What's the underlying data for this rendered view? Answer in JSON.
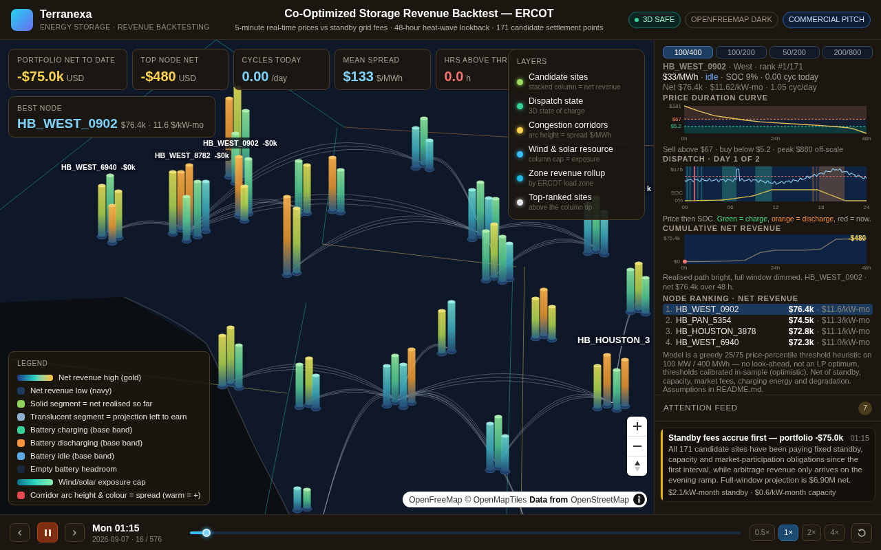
{
  "header": {
    "brand": "Terranexa",
    "tagline": "ENERGY STORAGE · REVENUE BACKTESTING",
    "title": "Co-Optimized Storage Revenue Backtest — ERCOT",
    "subtitle": "5-minute real-time prices vs standby grid fees · 48-hour heat-wave lookback · 171 candidate settlement points",
    "badges": [
      {
        "label": "3D SAFE",
        "kind": "status"
      },
      {
        "label": "OPENFREEMAP DARK",
        "kind": "neutral"
      },
      {
        "label": "COMMERCIAL PITCH",
        "kind": "mode"
      }
    ]
  },
  "kpis": [
    {
      "label": "PORTFOLIO NET TO DATE",
      "value": "-$75.0k",
      "unit": "USD",
      "color": "#fcd34d"
    },
    {
      "label": "TOP NODE NET",
      "value": "-$480",
      "unit": "USD",
      "color": "#fcd34d"
    },
    {
      "label": "CYCLES TODAY",
      "value": "0.00",
      "unit": "/day",
      "color": "#7dd3fc"
    },
    {
      "label": "MEAN SPREAD",
      "value": "$133",
      "unit": "$/MWh",
      "color": "#7dd3fc"
    },
    {
      "label": "HRS ABOVE THR",
      "value": "0.0",
      "unit": "h",
      "color": "#f87171"
    }
  ],
  "best_node": {
    "label": "BEST NODE",
    "name": "HB_WEST_0902",
    "detail": "$76.4k · 11.6 $/kW-mo"
  },
  "layers": {
    "title": "LAYERS",
    "items": [
      {
        "name": "Candidate sites",
        "hint": "stacked column = net revenue",
        "color": "#9ddc5c"
      },
      {
        "name": "Dispatch state",
        "hint": "3D state of charge",
        "color": "#34d399"
      },
      {
        "name": "Congestion corridors",
        "hint": "arc height = spread $/MWh",
        "color": "#fcd34d"
      },
      {
        "name": "Wind & solar resource",
        "hint": "column cap = exposure",
        "color": "#38bdf8"
      },
      {
        "name": "Zone revenue rollup",
        "hint": "by ERCOT load zone",
        "color": "#22b8e6"
      },
      {
        "name": "Top-ranked sites",
        "hint": "above the column tip",
        "color": "#e5e7eb"
      }
    ]
  },
  "map": {
    "site_labels": [
      {
        "name": "HB_WEST_0902",
        "net": "-$0k"
      },
      {
        "name": "HB_WEST_8782",
        "net": "-$0k"
      },
      {
        "name": "HB_WEST_6940",
        "net": "-$0k"
      },
      {
        "net": "k"
      },
      {
        "name": "HB_HOUSTON_3"
      }
    ],
    "attribution": [
      {
        "text": "OpenFreeMap",
        "kind": "link"
      },
      {
        "text": "© OpenMapTiles",
        "kind": "link"
      },
      {
        "text": "Data from",
        "kind": "text"
      },
      {
        "text": "OpenStreetMap",
        "kind": "link"
      }
    ]
  },
  "legend": {
    "title": "LEGEND",
    "items": [
      {
        "label": "Net revenue high (gold)",
        "kind": "revenue_ramp"
      },
      {
        "label": "Net revenue low (navy)",
        "kind": "swatch",
        "color": "#1e3a5f"
      },
      {
        "label": "Solid segment = net realised so far",
        "kind": "swatch",
        "color": "#8ed35a"
      },
      {
        "label": "Translucent segment = projection left to earn",
        "kind": "swatch",
        "color": "#8fb0cf"
      },
      {
        "label": "Battery charging (base band)",
        "kind": "swatch",
        "color": "#34d399"
      },
      {
        "label": "Battery discharging (base band)",
        "kind": "swatch",
        "color": "#fb923c"
      },
      {
        "label": "Battery idle (base band)",
        "kind": "swatch",
        "color": "#5aa9e6"
      },
      {
        "label": "Empty battery headroom",
        "kind": "swatch",
        "color": "#1a2840"
      },
      {
        "label": "Wind/solar exposure cap",
        "kind": "exposure_ramp"
      },
      {
        "label": "Corridor arc height & colour = spread (warm = +)",
        "kind": "swatch",
        "color": "#e5484d"
      }
    ]
  },
  "panel": {
    "tabs": [
      {
        "label": "100/400",
        "selected": true
      },
      {
        "label": "100/200",
        "selected": false
      },
      {
        "label": "50/200",
        "selected": false
      },
      {
        "label": "200/800",
        "selected": false
      }
    ],
    "node": {
      "heading": "**HB_WEST_0902** · West · rank #1/171",
      "live": [
        {
          "text": "$33/MWh",
          "kind": "value"
        },
        {
          "text": " · ",
          "kind": "plain"
        },
        {
          "text": "idle",
          "kind": "state"
        },
        {
          "text": " · SOC 9% · 0.00 cyc today",
          "kind": "plain"
        }
      ],
      "summary": "Net $76.4k · $11.62/kW-mo · 1.05 cyc/day"
    },
    "price_duration": {
      "heading": "PRICE DURATION CURVE",
      "chart_data": {
        "type": "line",
        "x": [
          0,
          4,
          8,
          12,
          16,
          20,
          24,
          28,
          32,
          36,
          40,
          44,
          48
        ],
        "series": [
          {
            "color": "#e6c35c",
            "values": [
              181,
              135,
              96,
              78,
              58,
              45,
              36,
              28,
              20,
              12,
              3,
              -10,
              -55
            ]
          }
        ],
        "xlim": [
          0,
          48
        ],
        "ylim": [
          -55,
          181
        ],
        "xticks": [
          {
            "value": 0,
            "label": "0h"
          },
          {
            "value": 24,
            "label": "24h"
          },
          {
            "value": 48,
            "label": "48h"
          }
        ],
        "yticks": [
          {
            "value": 181,
            "label": "$181"
          },
          {
            "value": 67,
            "label": "$67"
          },
          {
            "value": 5.2,
            "label": "$5.2"
          }
        ],
        "ref_lines": [
          {
            "axis": "y",
            "value": 67,
            "color": "#f0875a"
          },
          {
            "axis": "y",
            "value": 5.2,
            "color": "#34d3a0"
          }
        ],
        "bands": [
          {
            "axis": "y",
            "from": 67,
            "to": 181,
            "color": "#3b2c29"
          },
          {
            "axis": "y",
            "from": -55,
            "to": 5.2,
            "color": "#0f3a3c"
          }
        ]
      },
      "caption": "Sell above $67 · buy below $5.2 · peak $880 off-scale"
    },
    "dispatch": {
      "heading": "DISPATCH · DAY 1 OF 2",
      "y_labels": [
        "$175",
        "SOC",
        "0%"
      ],
      "x_labels": [
        "00",
        "06",
        "12",
        "18",
        "24"
      ],
      "caption": [
        {
          "text": "Price then SOC. ",
          "kind": "plain"
        },
        {
          "text": "Green = charge",
          "kind": "charge"
        },
        {
          "text": ", ",
          "kind": "plain"
        },
        {
          "text": "orange = discharge",
          "kind": "discharge"
        },
        {
          "text": ", red = now.",
          "kind": "plain"
        }
      ]
    },
    "cumulative": {
      "heading": "CUMULATIVE NET REVENUE",
      "chart_data": {
        "type": "line",
        "x": [
          0,
          4,
          8,
          12,
          16,
          20,
          24,
          28,
          32,
          36,
          40,
          44,
          48
        ],
        "series": [
          {
            "color": "#7a776c",
            "values": [
              0,
              0,
              1,
              2,
              4,
              30,
              38,
              38,
              38,
              42,
              74,
              75,
              76.4
            ]
          }
        ],
        "xlim": [
          0,
          48
        ],
        "ylim": [
          -8,
          90
        ],
        "xticks": [
          {
            "value": 0,
            "label": "0h"
          },
          {
            "value": 24,
            "label": "24h"
          },
          {
            "value": 48,
            "label": "48h"
          }
        ],
        "yticks": [
          {
            "value": 76.4,
            "label": "$76.4k"
          },
          {
            "value": 0,
            "label": "$0"
          }
        ],
        "annotations": [
          {
            "x": 48,
            "y": 76.4,
            "text": "-$480"
          }
        ]
      },
      "caption": "Realised path bright, full window dimmed. HB_WEST_0902 · net $76.4k over 48 h."
    },
    "ranking": {
      "heading": "NODE RANKING · NET REVENUE",
      "rows": [
        {
          "rank": "1.",
          "name": "HB_WEST_0902",
          "net": "$76.4k",
          "rate": "· $11.6/kW-mo",
          "selected": true
        },
        {
          "rank": "2.",
          "name": "HB_PAN_5354",
          "net": "$74.5k",
          "rate": "· $11.3/kW-mo",
          "selected": false
        },
        {
          "rank": "3.",
          "name": "HB_HOUSTON_3878",
          "net": "$72.8k",
          "rate": "· $11.1/kW-mo",
          "selected": false
        },
        {
          "rank": "4.",
          "name": "HB_WEST_6940",
          "net": "$72.3k",
          "rate": "· $11.0/kW-mo",
          "selected": false
        }
      ]
    },
    "note": "Model is a greedy 25/75 price-percentile threshold heuristic on 100 MW / 400 MWh — no look-ahead, not an LP optimum, thresholds calibrated in-sample (optimistic). Net of standby, capacity, market fees, charging energy and degradation. Assumptions in README.md."
  },
  "feed": {
    "title": "ATTENTION FEED",
    "count": "7",
    "items": [
      {
        "title": "Standby fees accrue first — portfolio -$75.0k",
        "time": "01:15",
        "body": "All 171 candidate sites have been paying fixed standby, capacity and market-participation obligations since the first interval, while arbitrage revenue only arrives on the evening ramp. Full-window projection is $6.90M net.",
        "footer": "$2.1/kW-month standby · $0.6/kW-month capacity",
        "color": "#eab308"
      }
    ]
  },
  "playback": {
    "playing": true,
    "time": "Mon 01:15",
    "detail": "2026-09-07 · 16 / 576",
    "level": 0.03,
    "speeds": [
      {
        "label": "0.5×",
        "selected": false
      },
      {
        "label": "1×",
        "selected": true
      },
      {
        "label": "2×",
        "selected": false
      },
      {
        "label": "4×",
        "selected": false
      }
    ]
  }
}
